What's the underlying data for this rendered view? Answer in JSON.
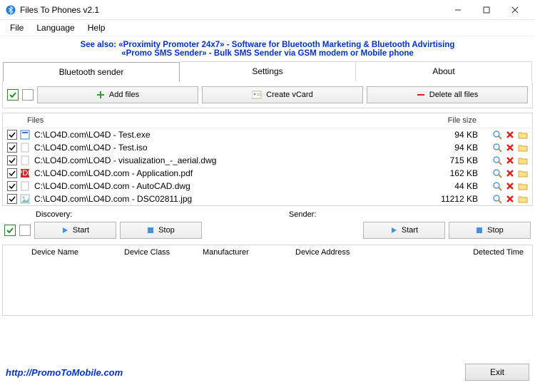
{
  "window": {
    "title": "Files To Phones v2.1"
  },
  "menubar": {
    "file": "File",
    "language": "Language",
    "help": "Help"
  },
  "promo": {
    "line1": "See also: «Proximity Promoter 24x7» - Software for Bluetooth Marketing & Bluetooth Advirtising",
    "line2": "«Promo SMS Sender» - Bulk SMS Sender via GSM modem or Mobile phone"
  },
  "tabs": {
    "bluetooth": "Bluetooth sender",
    "settings": "Settings",
    "about": "About"
  },
  "toolbar": {
    "add": "Add files",
    "vcard": "Create vCard",
    "delete": "Delete all files"
  },
  "fileTable": {
    "headFiles": "Files",
    "headSize": "File size",
    "rows": [
      {
        "name": "C:\\LO4D.com\\LO4D - Test.exe",
        "size": "94 KB",
        "icon": "exe"
      },
      {
        "name": "C:\\LO4D.com\\LO4D - Test.iso",
        "size": "94 KB",
        "icon": "blank"
      },
      {
        "name": "C:\\LO4D.com\\LO4D - visualization_-_aerial.dwg",
        "size": "715 KB",
        "icon": "blank"
      },
      {
        "name": "C:\\LO4D.com\\LO4D.com - Application.pdf",
        "size": "162 KB",
        "icon": "pdf"
      },
      {
        "name": "C:\\LO4D.com\\LO4D.com - AutoCAD.dwg",
        "size": "44 KB",
        "icon": "blank"
      },
      {
        "name": "C:\\LO4D.com\\LO4D.com - DSC02811.jpg",
        "size": "11212 KB",
        "icon": "img"
      }
    ]
  },
  "discovery": {
    "discoveryLabel": "Discovery:",
    "senderLabel": "Sender:",
    "start": "Start",
    "stop": "Stop"
  },
  "devTable": {
    "name": "Device Name",
    "class": "Device Class",
    "manu": "Manufacturer",
    "addr": "Device Address",
    "time": "Detected Time"
  },
  "footer": {
    "link": "http://PromoToMobile.com",
    "exit": "Exit"
  }
}
